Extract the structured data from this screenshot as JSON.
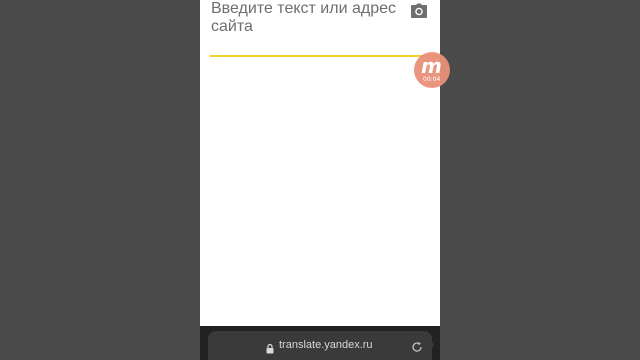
{
  "translate_input": {
    "placeholder": "Введите текст или адрес сайта"
  },
  "icons": {
    "camera": "camera-icon",
    "lock": "lock-icon",
    "reload": "reload-icon"
  },
  "recorder_badge": {
    "letter": "m",
    "timer": "00:04"
  },
  "browser_bar": {
    "url": "translate.yandex.ru"
  },
  "colors": {
    "accent_line": "#f2d12a",
    "badge": "#e9907a",
    "letterbox": "#4a4a4a"
  }
}
